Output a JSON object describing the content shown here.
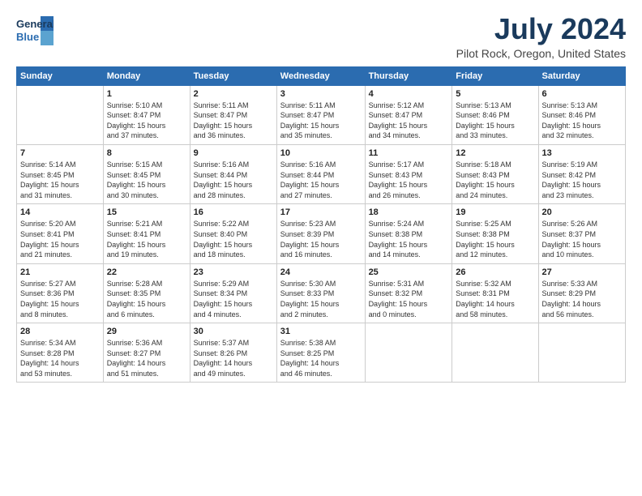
{
  "header": {
    "logo_line1": "General",
    "logo_line2": "Blue",
    "title": "July 2024",
    "subtitle": "Pilot Rock, Oregon, United States"
  },
  "days_of_week": [
    "Sunday",
    "Monday",
    "Tuesday",
    "Wednesday",
    "Thursday",
    "Friday",
    "Saturday"
  ],
  "weeks": [
    [
      {
        "day": "",
        "info": ""
      },
      {
        "day": "1",
        "info": "Sunrise: 5:10 AM\nSunset: 8:47 PM\nDaylight: 15 hours\nand 37 minutes."
      },
      {
        "day": "2",
        "info": "Sunrise: 5:11 AM\nSunset: 8:47 PM\nDaylight: 15 hours\nand 36 minutes."
      },
      {
        "day": "3",
        "info": "Sunrise: 5:11 AM\nSunset: 8:47 PM\nDaylight: 15 hours\nand 35 minutes."
      },
      {
        "day": "4",
        "info": "Sunrise: 5:12 AM\nSunset: 8:47 PM\nDaylight: 15 hours\nand 34 minutes."
      },
      {
        "day": "5",
        "info": "Sunrise: 5:13 AM\nSunset: 8:46 PM\nDaylight: 15 hours\nand 33 minutes."
      },
      {
        "day": "6",
        "info": "Sunrise: 5:13 AM\nSunset: 8:46 PM\nDaylight: 15 hours\nand 32 minutes."
      }
    ],
    [
      {
        "day": "7",
        "info": "Sunrise: 5:14 AM\nSunset: 8:45 PM\nDaylight: 15 hours\nand 31 minutes."
      },
      {
        "day": "8",
        "info": "Sunrise: 5:15 AM\nSunset: 8:45 PM\nDaylight: 15 hours\nand 30 minutes."
      },
      {
        "day": "9",
        "info": "Sunrise: 5:16 AM\nSunset: 8:44 PM\nDaylight: 15 hours\nand 28 minutes."
      },
      {
        "day": "10",
        "info": "Sunrise: 5:16 AM\nSunset: 8:44 PM\nDaylight: 15 hours\nand 27 minutes."
      },
      {
        "day": "11",
        "info": "Sunrise: 5:17 AM\nSunset: 8:43 PM\nDaylight: 15 hours\nand 26 minutes."
      },
      {
        "day": "12",
        "info": "Sunrise: 5:18 AM\nSunset: 8:43 PM\nDaylight: 15 hours\nand 24 minutes."
      },
      {
        "day": "13",
        "info": "Sunrise: 5:19 AM\nSunset: 8:42 PM\nDaylight: 15 hours\nand 23 minutes."
      }
    ],
    [
      {
        "day": "14",
        "info": "Sunrise: 5:20 AM\nSunset: 8:41 PM\nDaylight: 15 hours\nand 21 minutes."
      },
      {
        "day": "15",
        "info": "Sunrise: 5:21 AM\nSunset: 8:41 PM\nDaylight: 15 hours\nand 19 minutes."
      },
      {
        "day": "16",
        "info": "Sunrise: 5:22 AM\nSunset: 8:40 PM\nDaylight: 15 hours\nand 18 minutes."
      },
      {
        "day": "17",
        "info": "Sunrise: 5:23 AM\nSunset: 8:39 PM\nDaylight: 15 hours\nand 16 minutes."
      },
      {
        "day": "18",
        "info": "Sunrise: 5:24 AM\nSunset: 8:38 PM\nDaylight: 15 hours\nand 14 minutes."
      },
      {
        "day": "19",
        "info": "Sunrise: 5:25 AM\nSunset: 8:38 PM\nDaylight: 15 hours\nand 12 minutes."
      },
      {
        "day": "20",
        "info": "Sunrise: 5:26 AM\nSunset: 8:37 PM\nDaylight: 15 hours\nand 10 minutes."
      }
    ],
    [
      {
        "day": "21",
        "info": "Sunrise: 5:27 AM\nSunset: 8:36 PM\nDaylight: 15 hours\nand 8 minutes."
      },
      {
        "day": "22",
        "info": "Sunrise: 5:28 AM\nSunset: 8:35 PM\nDaylight: 15 hours\nand 6 minutes."
      },
      {
        "day": "23",
        "info": "Sunrise: 5:29 AM\nSunset: 8:34 PM\nDaylight: 15 hours\nand 4 minutes."
      },
      {
        "day": "24",
        "info": "Sunrise: 5:30 AM\nSunset: 8:33 PM\nDaylight: 15 hours\nand 2 minutes."
      },
      {
        "day": "25",
        "info": "Sunrise: 5:31 AM\nSunset: 8:32 PM\nDaylight: 15 hours\nand 0 minutes."
      },
      {
        "day": "26",
        "info": "Sunrise: 5:32 AM\nSunset: 8:31 PM\nDaylight: 14 hours\nand 58 minutes."
      },
      {
        "day": "27",
        "info": "Sunrise: 5:33 AM\nSunset: 8:29 PM\nDaylight: 14 hours\nand 56 minutes."
      }
    ],
    [
      {
        "day": "28",
        "info": "Sunrise: 5:34 AM\nSunset: 8:28 PM\nDaylight: 14 hours\nand 53 minutes."
      },
      {
        "day": "29",
        "info": "Sunrise: 5:36 AM\nSunset: 8:27 PM\nDaylight: 14 hours\nand 51 minutes."
      },
      {
        "day": "30",
        "info": "Sunrise: 5:37 AM\nSunset: 8:26 PM\nDaylight: 14 hours\nand 49 minutes."
      },
      {
        "day": "31",
        "info": "Sunrise: 5:38 AM\nSunset: 8:25 PM\nDaylight: 14 hours\nand 46 minutes."
      },
      {
        "day": "",
        "info": ""
      },
      {
        "day": "",
        "info": ""
      },
      {
        "day": "",
        "info": ""
      }
    ]
  ]
}
